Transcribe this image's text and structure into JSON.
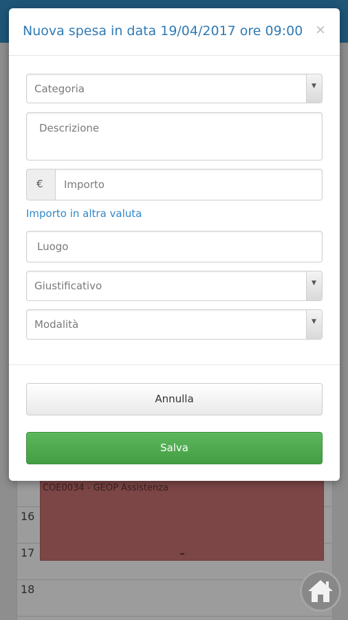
{
  "modal": {
    "title": "Nuova spesa in data 19/04/2017 ore 09:00",
    "close_icon": "×"
  },
  "form": {
    "categoria_placeholder": "Categoria",
    "descrizione_placeholder": "Descrizione",
    "currency_symbol": "€",
    "importo_placeholder": "Importo",
    "altra_valuta_link": "Importo in altra valuta",
    "luogo_placeholder": "Luogo",
    "giustificativo_placeholder": "Giustificativo",
    "modalita_placeholder": "Modalità",
    "select_arrow": "▼"
  },
  "buttons": {
    "cancel_label": "Annulla",
    "save_label": "Salva"
  },
  "background_calendar": {
    "hours": [
      "16",
      "17",
      "18"
    ],
    "event_title": "COE0034 - GEOP Assistenza",
    "event_color": "#7c4646"
  },
  "colors": {
    "header_bg": "#1f5577",
    "title": "#2f7ab3",
    "link": "#2f88c8",
    "save_button": "#449d44"
  },
  "icons": {
    "home_button": "home-icon"
  }
}
